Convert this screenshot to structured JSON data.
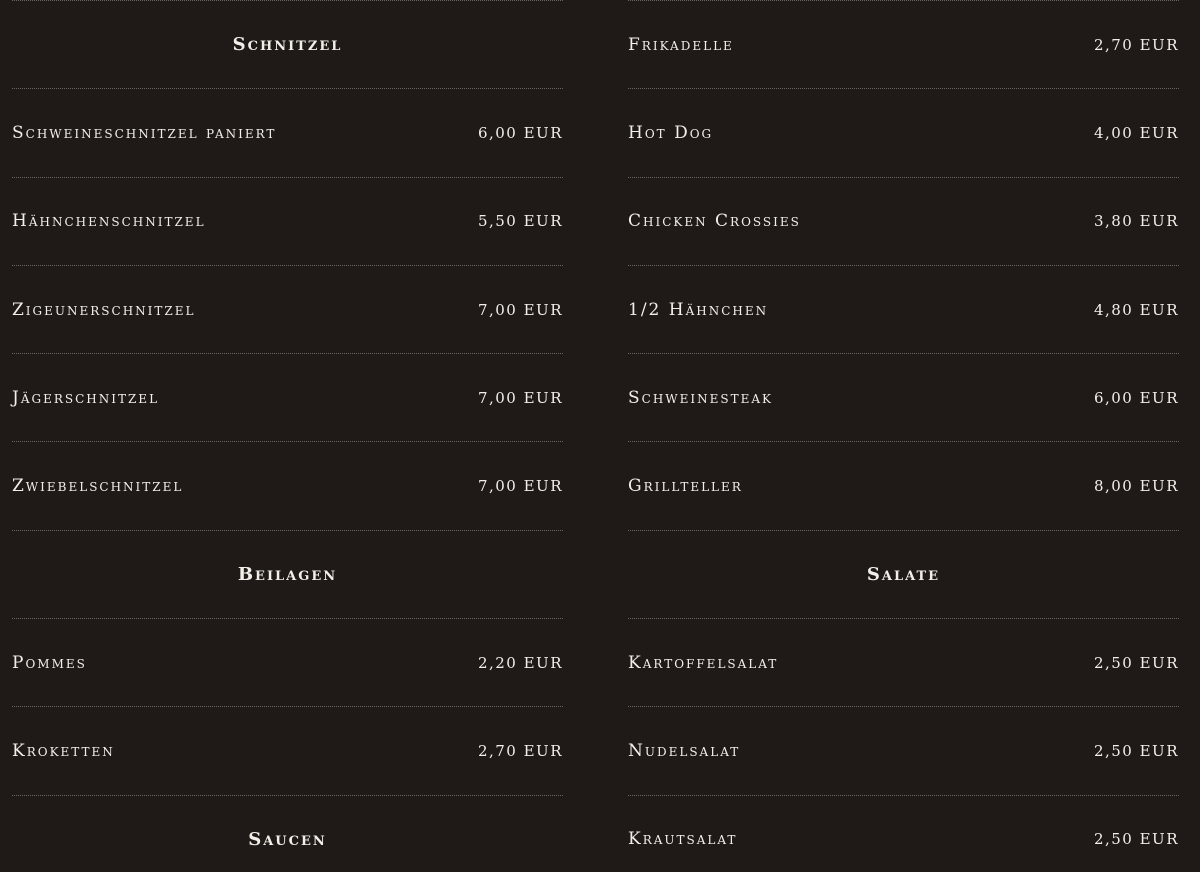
{
  "left_column": {
    "schnitzel": {
      "title": "Schnitzel",
      "items": [
        {
          "name": "Schweineschnitzel paniert",
          "price": "6,00 EUR"
        },
        {
          "name": "Hähnchenschnitzel",
          "price": "5,50 EUR"
        },
        {
          "name": "Zigeunerschnitzel",
          "price": "7,00 EUR"
        },
        {
          "name": "Jägerschnitzel",
          "price": "7,00 EUR"
        },
        {
          "name": "Zwiebelschnitzel",
          "price": "7,00 EUR"
        }
      ]
    },
    "beilagen": {
      "title": "Beilagen",
      "items": [
        {
          "name": "Pommes",
          "price": "2,20 EUR"
        },
        {
          "name": "Kroketten",
          "price": "2,70 EUR"
        }
      ]
    },
    "saucen": {
      "title": "Saucen"
    }
  },
  "right_column": {
    "grill": {
      "items": [
        {
          "name": "Frikadelle",
          "price": "2,70 EUR"
        },
        {
          "name": "Hot Dog",
          "price": "4,00 EUR"
        },
        {
          "name": "Chicken Crossies",
          "price": "3,80 EUR"
        },
        {
          "name": "1/2 Hähnchen",
          "price": "4,80 EUR"
        },
        {
          "name": "Schweinesteak",
          "price": "6,00 EUR"
        },
        {
          "name": "Grillteller",
          "price": "8,00 EUR"
        }
      ]
    },
    "salate": {
      "title": "Salate",
      "items": [
        {
          "name": "Kartoffelsalat",
          "price": "2,50 EUR"
        },
        {
          "name": "Nudelsalat",
          "price": "2,50 EUR"
        },
        {
          "name": "Krautsalat",
          "price": "2,50 EUR"
        }
      ]
    }
  }
}
